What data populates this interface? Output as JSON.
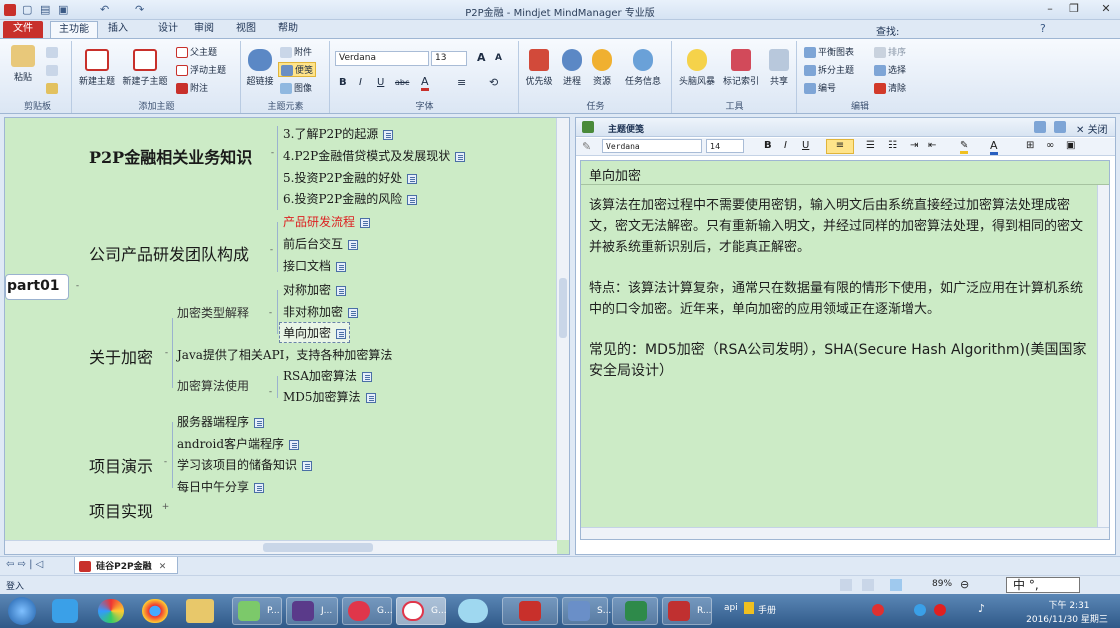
{
  "window": {
    "title": "P2P金融 - Mindjet MindManager 专业版",
    "find_label": "查找:"
  },
  "ribbon": {
    "tabs": [
      "文件",
      "主功能",
      "插入",
      "设计",
      "审阅",
      "视图",
      "帮助"
    ],
    "groups": {
      "clipboard": {
        "label": "剪贴板",
        "paste": "粘贴"
      },
      "add_topics": {
        "label": "添加主题",
        "new_topic": "新建主题",
        "new_subtopic": "新建子主题",
        "parent_topic": "父主题",
        "floating_topic": "浮动主题",
        "callout": "附注"
      },
      "topic_elements": {
        "label": "主题元素",
        "hyperlink": "超链接",
        "attachment": "附件",
        "notes": "便笺",
        "image": "图像"
      },
      "font": {
        "label": "字体",
        "font_name": "Verdana",
        "font_size": "13",
        "bold": "B",
        "italic": "I",
        "underline": "U",
        "strike": "abc"
      },
      "task": {
        "label": "任务",
        "priority": "优先级",
        "progress": "进程",
        "resource": "资源",
        "task_info": "任务信息"
      },
      "tools": {
        "label": "工具",
        "brainstorm": "头脑风暴",
        "markers": "标记索引",
        "share": "共享"
      },
      "edit": {
        "label": "编辑",
        "balance_map": "平衡图表",
        "split_topic": "拆分主题",
        "numbering": "编号",
        "sort": "排序",
        "select": "选择",
        "clear": "清除"
      }
    }
  },
  "map": {
    "root": "part01",
    "branches": [
      {
        "label": "P2P金融相关业务知识",
        "children": [
          "3.了解P2P的起源",
          "4.P2P金融借贷模式及发展现状",
          "5.投资P2P金融的好处",
          "6.投资P2P金融的风险"
        ]
      },
      {
        "label": "公司产品研发团队构成",
        "children": [
          "产品研发流程",
          "前后台交互",
          "接口文档"
        ]
      },
      {
        "label": "关于加密",
        "groups": [
          {
            "label": "加密类型解释",
            "children": [
              "对称加密",
              "非对称加密",
              "单向加密"
            ]
          },
          {
            "label": "Java提供了相关API，支持各种加密算法"
          },
          {
            "label": "加密算法使用",
            "children": [
              "RSA加密算法",
              "MD5加密算法"
            ]
          }
        ]
      },
      {
        "label": "项目演示",
        "children": [
          "服务器端程序",
          "android客户端程序",
          "学习该项目的储备知识",
          "每日中午分享"
        ]
      },
      {
        "label": "项目实现"
      }
    ],
    "expand_toggle": "+",
    "collapse_toggle": "-"
  },
  "notes_pane": {
    "title": "主题便笺",
    "close_label": "关闭",
    "font_name": "Verdana",
    "font_size": "14",
    "topic_title": "单向加密",
    "paragraphs": [
      "该算法在加密过程中不需要使用密钥，输入明文后由系统直接经过加密算法处理成密文，密文无法解密。只有重新输入明文，并经过同样的加密算法处理，得到相同的密文并被系统重新识别后，才能真正解密。",
      "特点：该算法计算复杂，通常只在数据量有限的情形下使用，如广泛应用在计算机系统中的口令加密。近年来，单向加密的应用领域正在逐渐增大。",
      "常见的：MD5加密（RSA公司发明），SHA(Secure Hash Algorithm)(美国国家安全局设计）"
    ]
  },
  "doc_tab": {
    "label": "硅谷P2P金融"
  },
  "status": {
    "login": "登入",
    "zoom": "89%",
    "ime": "中 °,"
  },
  "taskbar": {
    "apps": [
      "P...",
      "J...",
      "G...",
      "G...",
      "S...",
      "R...",
      "api",
      "手册"
    ],
    "time": "下午 2:31",
    "date": "2016/11/30 星期三"
  },
  "colors": {
    "map_bg": "#ccebc6",
    "accent_red": "#d22222",
    "file_tab": "#c8302b"
  }
}
